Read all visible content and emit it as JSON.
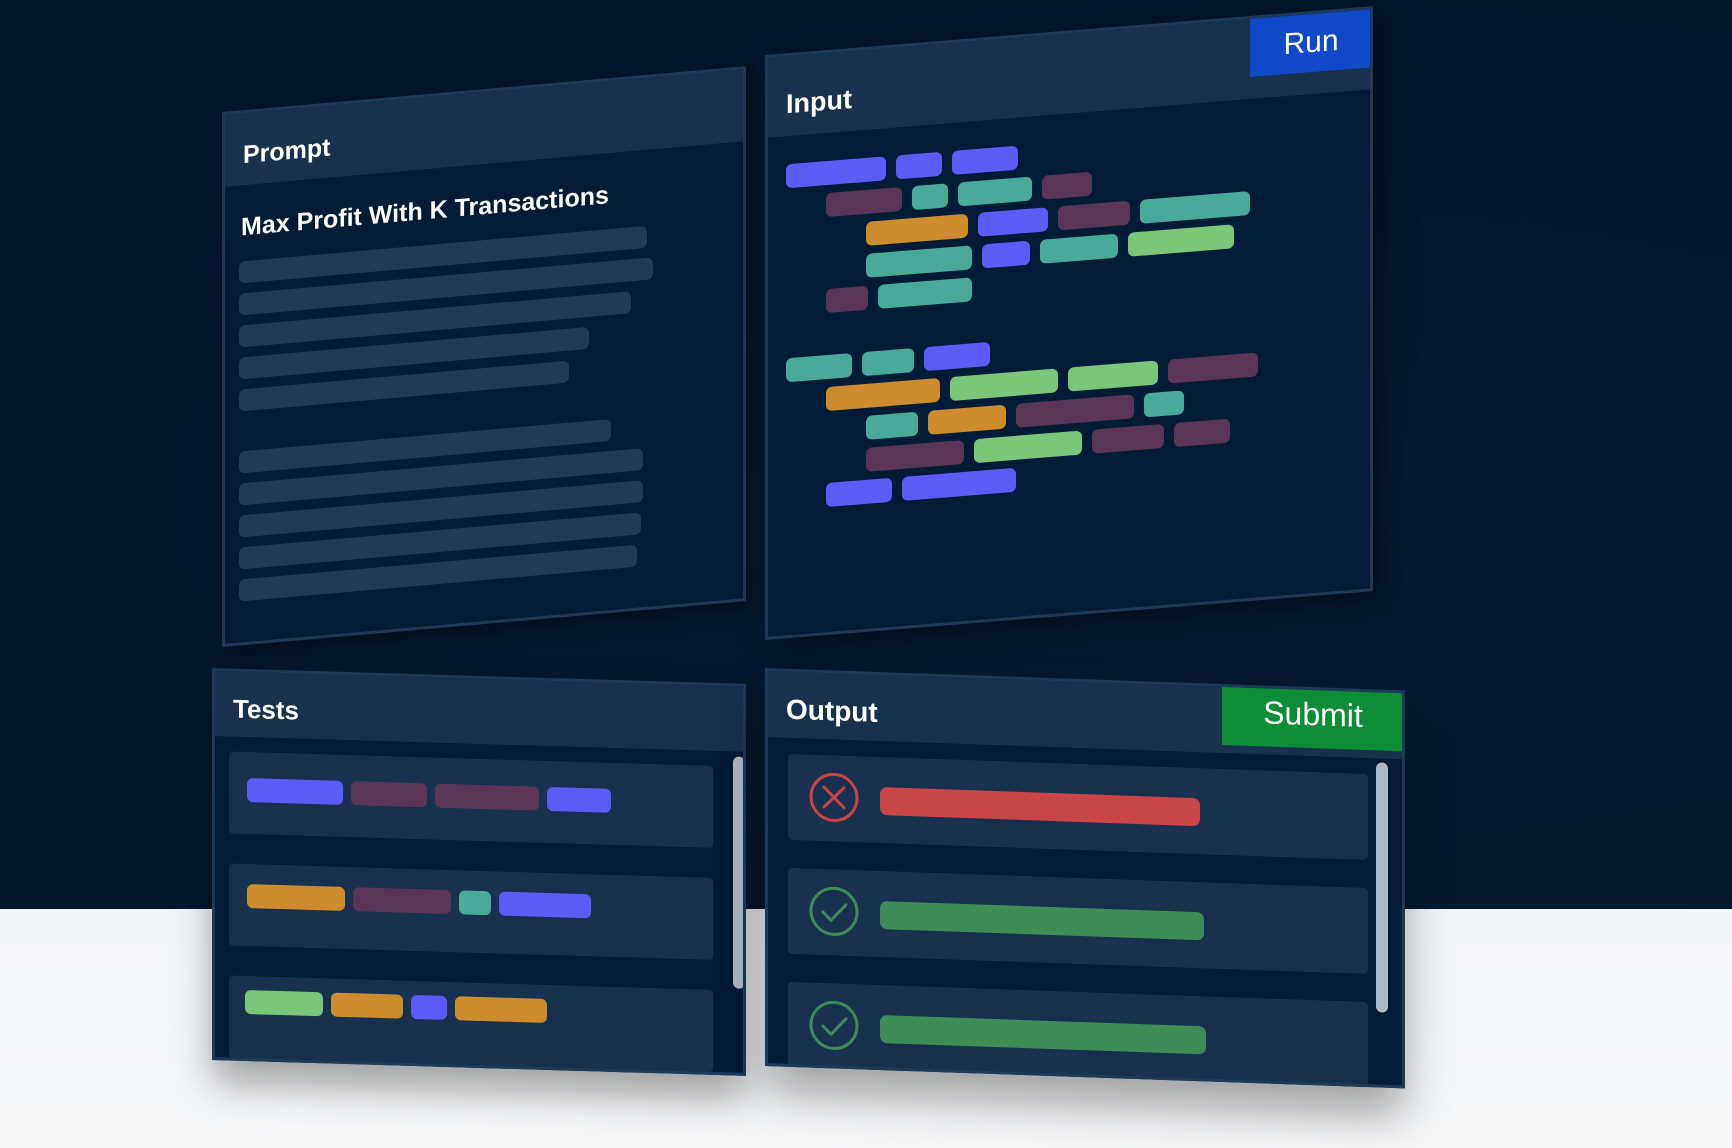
{
  "prompt": {
    "title": "Prompt",
    "heading": "Max Profit With K Transactions"
  },
  "input": {
    "title": "Input",
    "run_label": "Run"
  },
  "tests": {
    "title": "Tests"
  },
  "output": {
    "title": "Output",
    "submit_label": "Submit",
    "results": [
      {
        "status": "fail",
        "icon": "x-circle-icon"
      },
      {
        "status": "pass",
        "icon": "check-circle-icon"
      },
      {
        "status": "pass",
        "icon": "check-circle-icon"
      }
    ]
  },
  "colors": {
    "background": "#031a33",
    "panel": "#021b36",
    "panel_header": "#17314f",
    "run_button": "#1249c9",
    "submit_button": "#0c8d36",
    "fail": "#c94444",
    "pass": "#3f8b55",
    "token_blue": "#5b5cf6",
    "token_plum": "#5a3656",
    "token_teal": "#49aa9a",
    "token_orange": "#cd8c2d",
    "token_green": "#7cc67a"
  }
}
